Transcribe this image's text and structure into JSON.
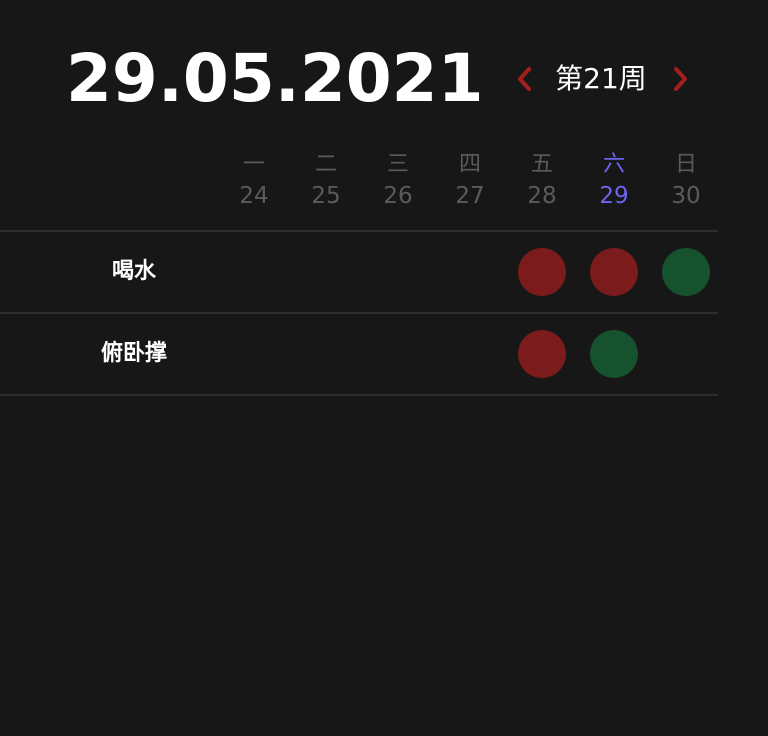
{
  "header": {
    "date": "29.05.2021",
    "week_label": "第21周",
    "prev_icon": "chevron-left-icon",
    "next_icon": "chevron-right-icon"
  },
  "colors": {
    "background": "#171717",
    "accent_today": "#6c63f0",
    "chevron": "#a21f1f",
    "status_fail": "#7b1b1b",
    "status_done": "#16522d",
    "muted_text": "#5b5b5b"
  },
  "days": [
    {
      "name": "一",
      "num": "24",
      "today": false
    },
    {
      "name": "二",
      "num": "25",
      "today": false
    },
    {
      "name": "三",
      "num": "26",
      "today": false
    },
    {
      "name": "四",
      "num": "27",
      "today": false
    },
    {
      "name": "五",
      "num": "28",
      "today": false
    },
    {
      "name": "六",
      "num": "29",
      "today": true
    },
    {
      "name": "日",
      "num": "30",
      "today": false
    }
  ],
  "habits": [
    {
      "name": "喝水",
      "status": [
        "",
        "",
        "",
        "",
        "fail",
        "fail",
        "done"
      ]
    },
    {
      "name": "俯卧撑",
      "status": [
        "",
        "",
        "",
        "",
        "fail",
        "done",
        ""
      ]
    }
  ]
}
